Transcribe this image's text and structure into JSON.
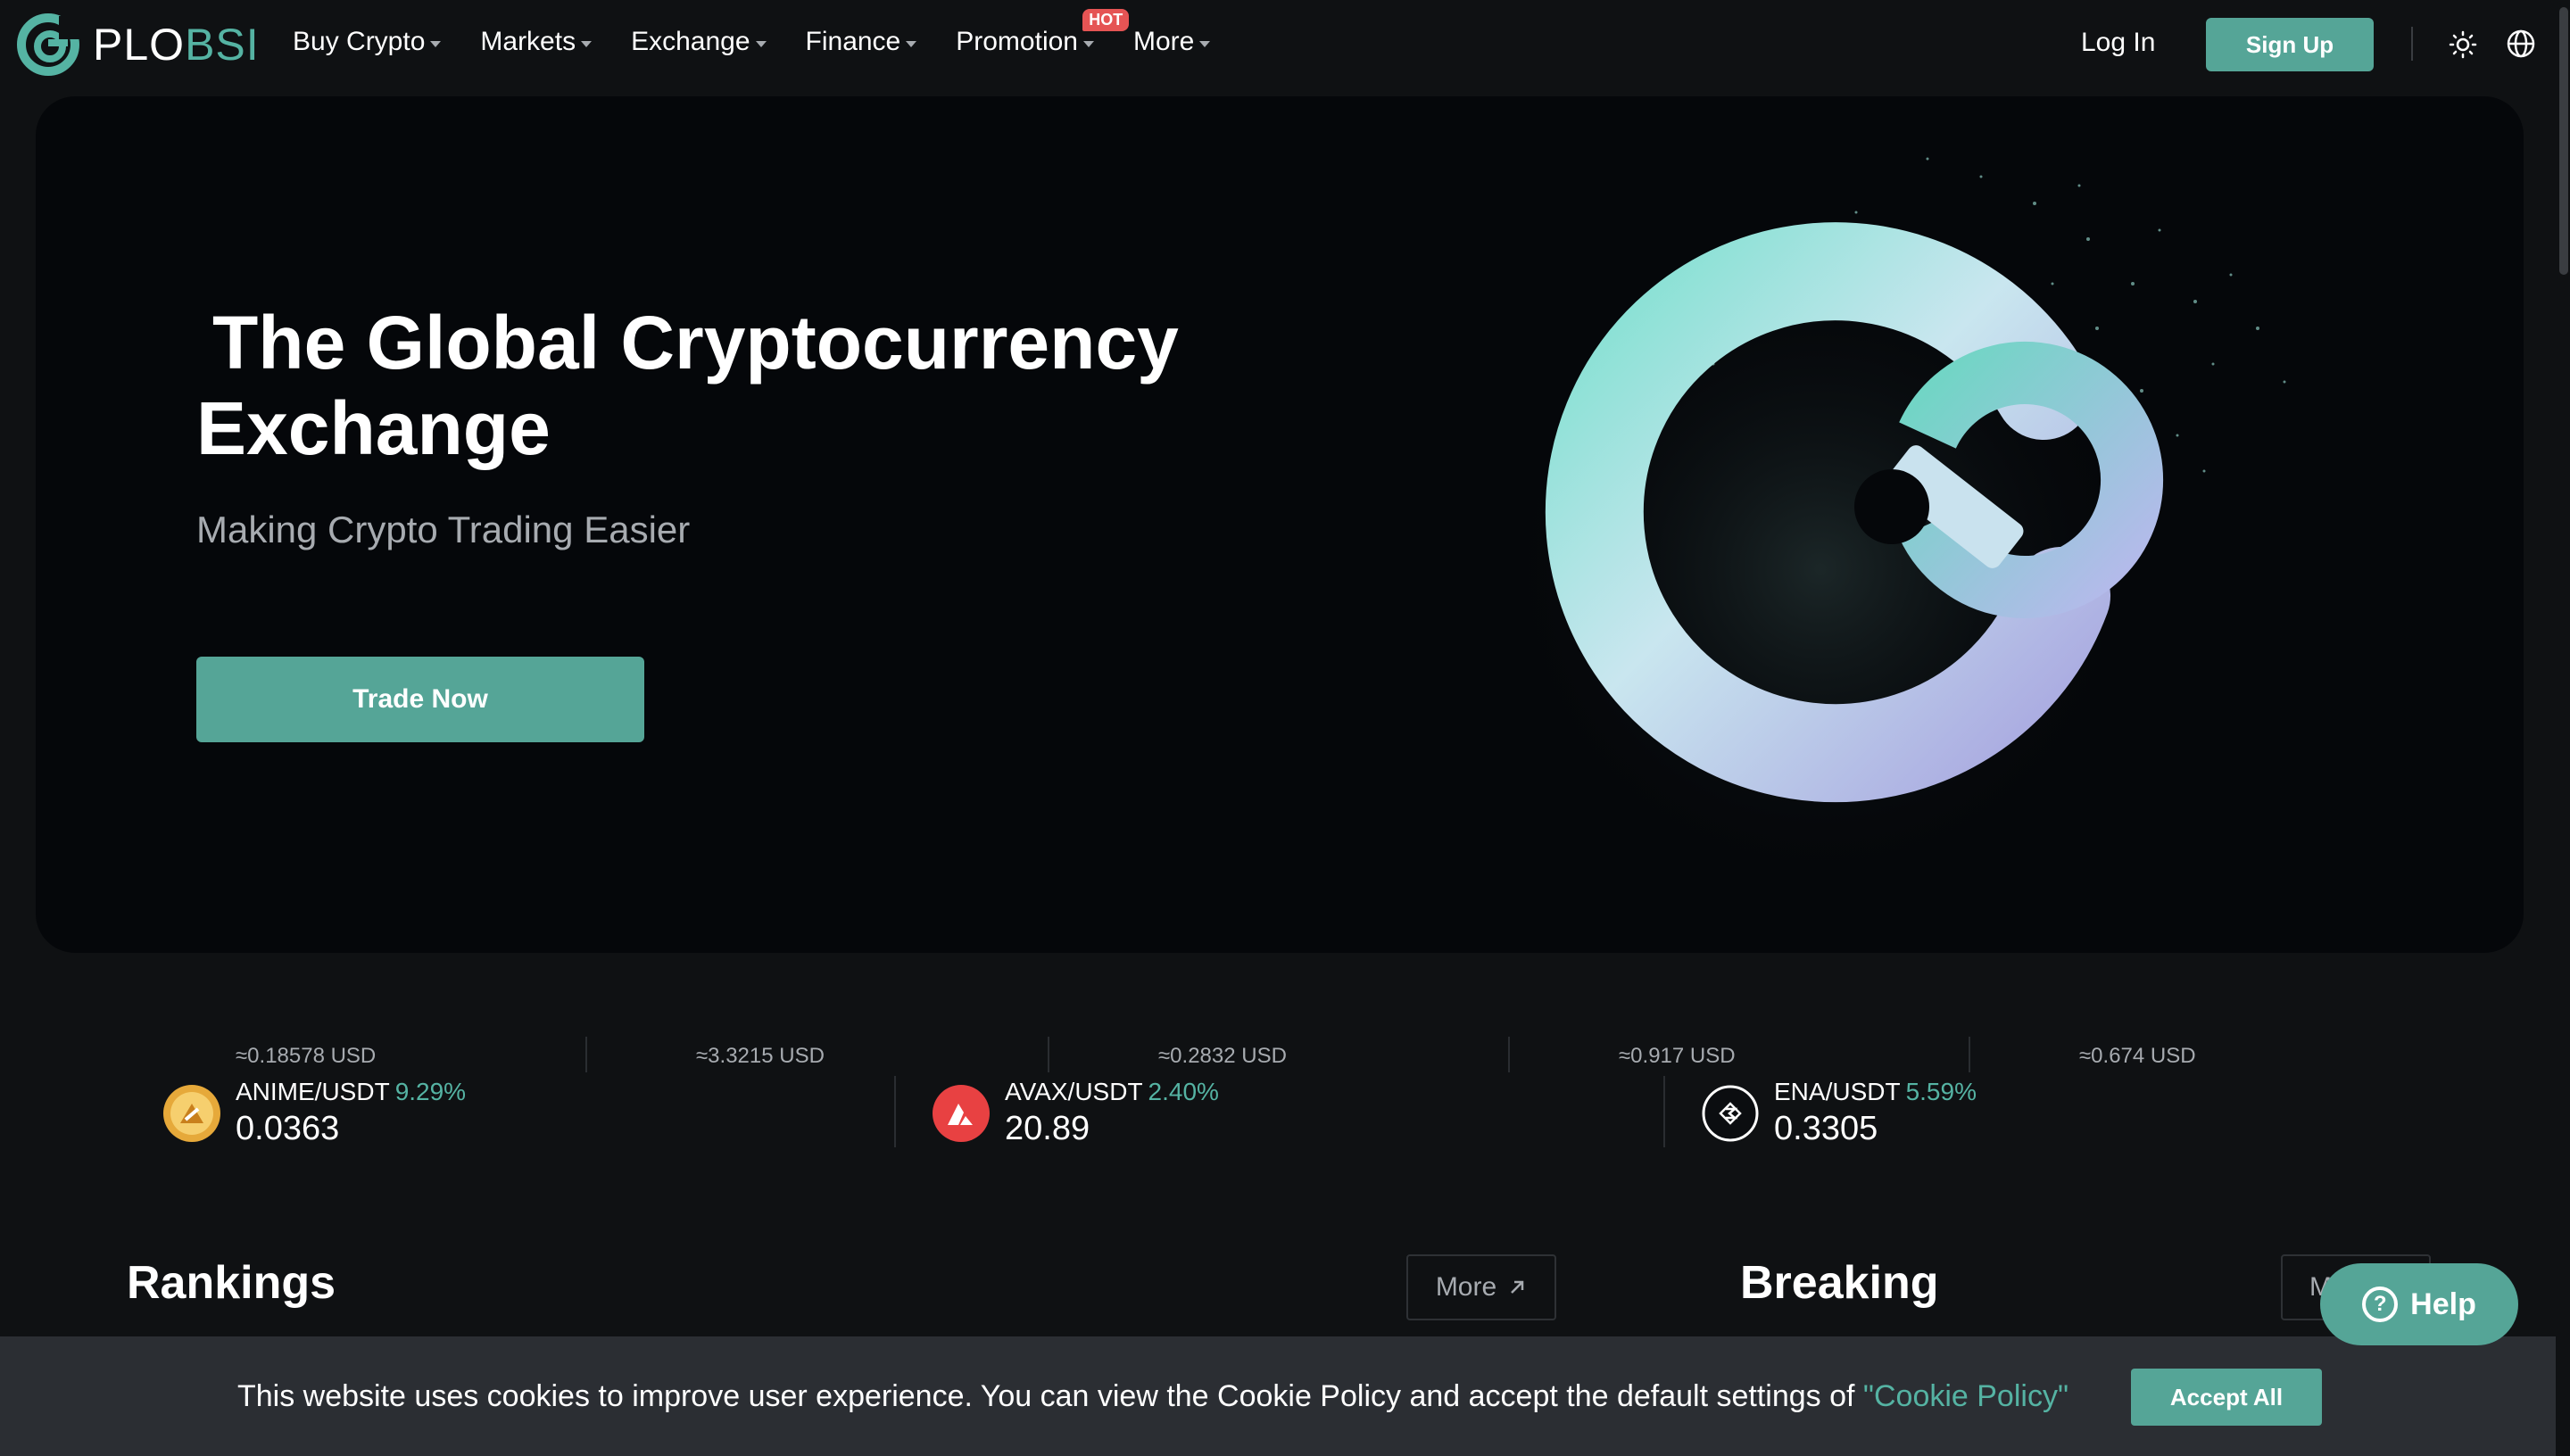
{
  "nav": {
    "logo_text_white": "PLO",
    "logo_text_green": "BSI",
    "menu": [
      {
        "label": "Buy Crypto"
      },
      {
        "label": "Markets"
      },
      {
        "label": "Exchange"
      },
      {
        "label": "Finance"
      },
      {
        "label": "Promotion",
        "badge": "HOT"
      },
      {
        "label": "More"
      }
    ],
    "login": "Log In",
    "signup": "Sign Up",
    "icons": [
      "sun-icon",
      "globe-icon"
    ]
  },
  "hero": {
    "title_line1": "The Global Cryptocurrency",
    "title_line2": "Exchange",
    "subtitle": "Making Crypto Trading Easier",
    "cta": "Trade Now"
  },
  "ticker": {
    "usd_refs": [
      "≈0.18578 USD",
      "≈3.3215 USD",
      "≈0.2832 USD",
      "≈0.917 USD",
      "≈0.674 USD"
    ],
    "cards": [
      {
        "pair": "ANIME/USDT",
        "change": "9.29%",
        "price": "0.0363",
        "icon": "anime-coin-icon"
      },
      {
        "pair": "AVAX/USDT",
        "change": "2.40%",
        "price": "20.89",
        "icon": "avax-coin-icon"
      },
      {
        "pair": "ENA/USDT",
        "change": "5.59%",
        "price": "0.3305",
        "icon": "ena-coin-icon"
      }
    ]
  },
  "sections": {
    "rankings_title": "Rankings",
    "rankings_more": "More",
    "breaking_title": "Breaking",
    "breaking_more": "M"
  },
  "cookie": {
    "text": "This website uses cookies to improve user experience. You can view the Cookie Policy and accept the default settings of ",
    "link": "\"Cookie Policy\"",
    "accept": "Accept All"
  },
  "help": {
    "label": "Help"
  },
  "colors": {
    "accent": "#55a597",
    "accent_text": "#55b3a3",
    "background": "#0f1113",
    "hero_bg": "#05070a",
    "hot": "#e55454"
  }
}
